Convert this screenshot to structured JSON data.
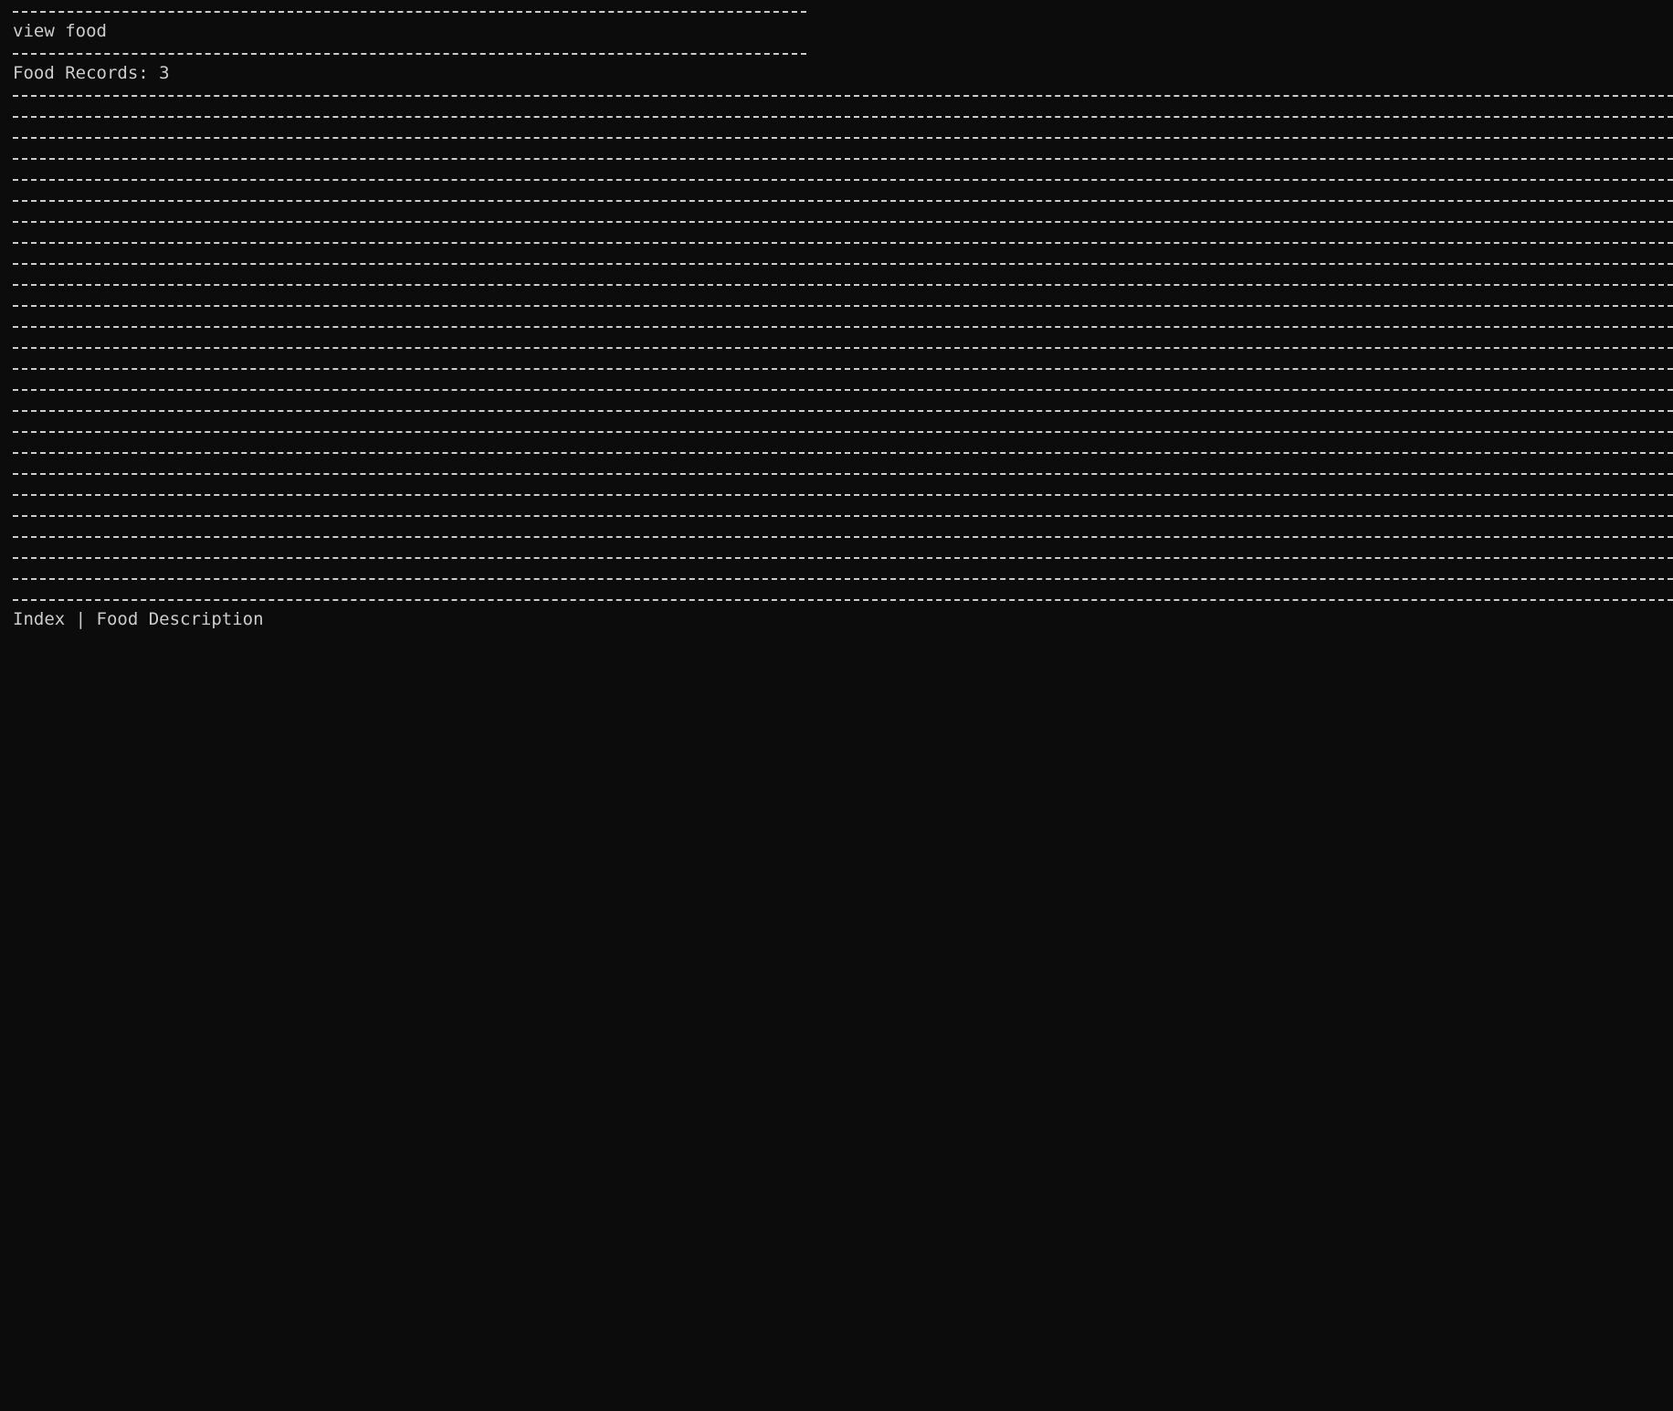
{
  "terminal": {
    "command": "view food",
    "records_label": "Food Records: 3",
    "table_header": "Index | Food Description"
  },
  "colors": {
    "background": "#0c0c0c",
    "foreground": "#cccccc"
  }
}
